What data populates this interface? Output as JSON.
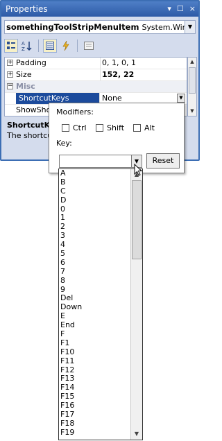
{
  "window": {
    "title": "Properties",
    "pin_icon": "pin-icon",
    "maximize_icon": "maximize-icon",
    "close_glyph": "×"
  },
  "object_selector": {
    "name": "somethingToolStripMenuItem",
    "type": "System.Windows"
  },
  "grid": {
    "rows": [
      {
        "name": "Padding",
        "value": "0, 1, 0, 1",
        "expander": "+"
      },
      {
        "name": "Size",
        "value": "152, 22",
        "expander": "+"
      },
      {
        "name": "Misc",
        "expander": "−"
      },
      {
        "name": "ShortcutKeys",
        "value": "None"
      },
      {
        "name": "ShowShor",
        "value": ""
      }
    ]
  },
  "description": {
    "title": "ShortcutKe",
    "text": "The shortcut"
  },
  "editor": {
    "modifiers_label": "Modifiers:",
    "ctrl": "Ctrl",
    "shift": "Shift",
    "alt": "Alt",
    "key_label": "Key:",
    "key_value": "",
    "reset_label": "Reset"
  },
  "key_list": [
    "A",
    "B",
    "C",
    "D",
    "0",
    "1",
    "2",
    "3",
    "4",
    "5",
    "6",
    "7",
    "8",
    "9",
    "Del",
    "Down",
    "E",
    "End",
    "F",
    "F1",
    "F10",
    "F11",
    "F12",
    "F13",
    "F14",
    "F15",
    "F16",
    "F17",
    "F18",
    "F19"
  ]
}
